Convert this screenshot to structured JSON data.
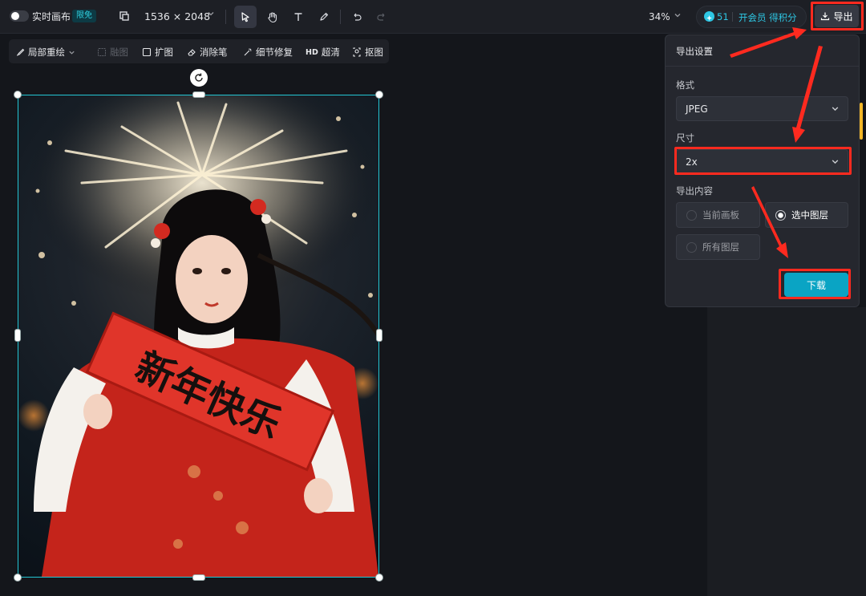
{
  "topbar": {
    "realtime_label": "实时画布",
    "badge": "限免",
    "canvas_size": "1536 × 2048",
    "zoom": "34%",
    "points": "51",
    "member_cta": "开会员 得积分",
    "export_label": "导出"
  },
  "subtoolbar": {
    "items": [
      {
        "label": "局部重绘",
        "icon": "brush-icon",
        "enabled": true
      },
      {
        "label": "融图",
        "icon": "merge-icon",
        "enabled": false
      },
      {
        "label": "扩图",
        "icon": "expand-icon",
        "enabled": true
      },
      {
        "label": "消除笔",
        "icon": "eraser-icon",
        "enabled": true
      },
      {
        "label": "细节修复",
        "icon": "magic-wand-icon",
        "enabled": true
      },
      {
        "label": "超清",
        "icon": "hd-icon",
        "icon_text": "HD",
        "enabled": true
      },
      {
        "label": "抠图",
        "icon": "cutout-icon",
        "enabled": true
      }
    ]
  },
  "canvas": {
    "banner_text": "新年快乐"
  },
  "export_panel": {
    "title": "导出设置",
    "format_label": "格式",
    "format_value": "JPEG",
    "size_label": "尺寸",
    "size_value": "2x",
    "content_label": "导出内容",
    "content_options": [
      {
        "label": "当前画板",
        "selected": false
      },
      {
        "label": "选中图层",
        "selected": true
      },
      {
        "label": "所有图层",
        "selected": false
      }
    ],
    "download_label": "下载"
  },
  "colors": {
    "accent": "#0aa4c4",
    "selection": "#23c6d4",
    "annotation": "#ff2a1f"
  }
}
